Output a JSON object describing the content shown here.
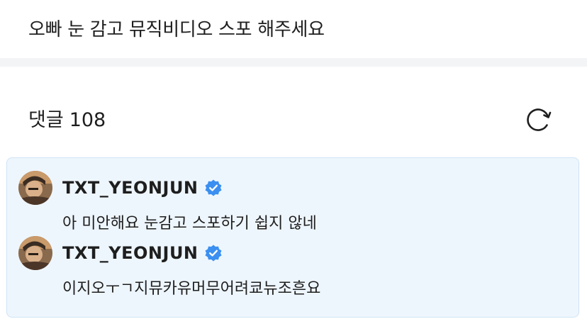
{
  "post": {
    "text": "오빠 눈 감고 뮤직비디오 스포 해주세요"
  },
  "comments_section": {
    "label": "댓글",
    "count": "108",
    "refresh_icon": "refresh-icon"
  },
  "comments": [
    {
      "author": "TXT_YEONJUN",
      "verified": true,
      "text": "아 미안해요 눈감고 스포하기 쉽지 않네"
    },
    {
      "author": "TXT_YEONJUN",
      "verified": true,
      "text": "이지오ㅜㄱ지뮤카유머무어려쿄뉴조흔요"
    }
  ],
  "colors": {
    "highlight_bg": "#eef6fd",
    "highlight_border": "#cfe3f5",
    "verified_blue": "#3b8ff0"
  }
}
